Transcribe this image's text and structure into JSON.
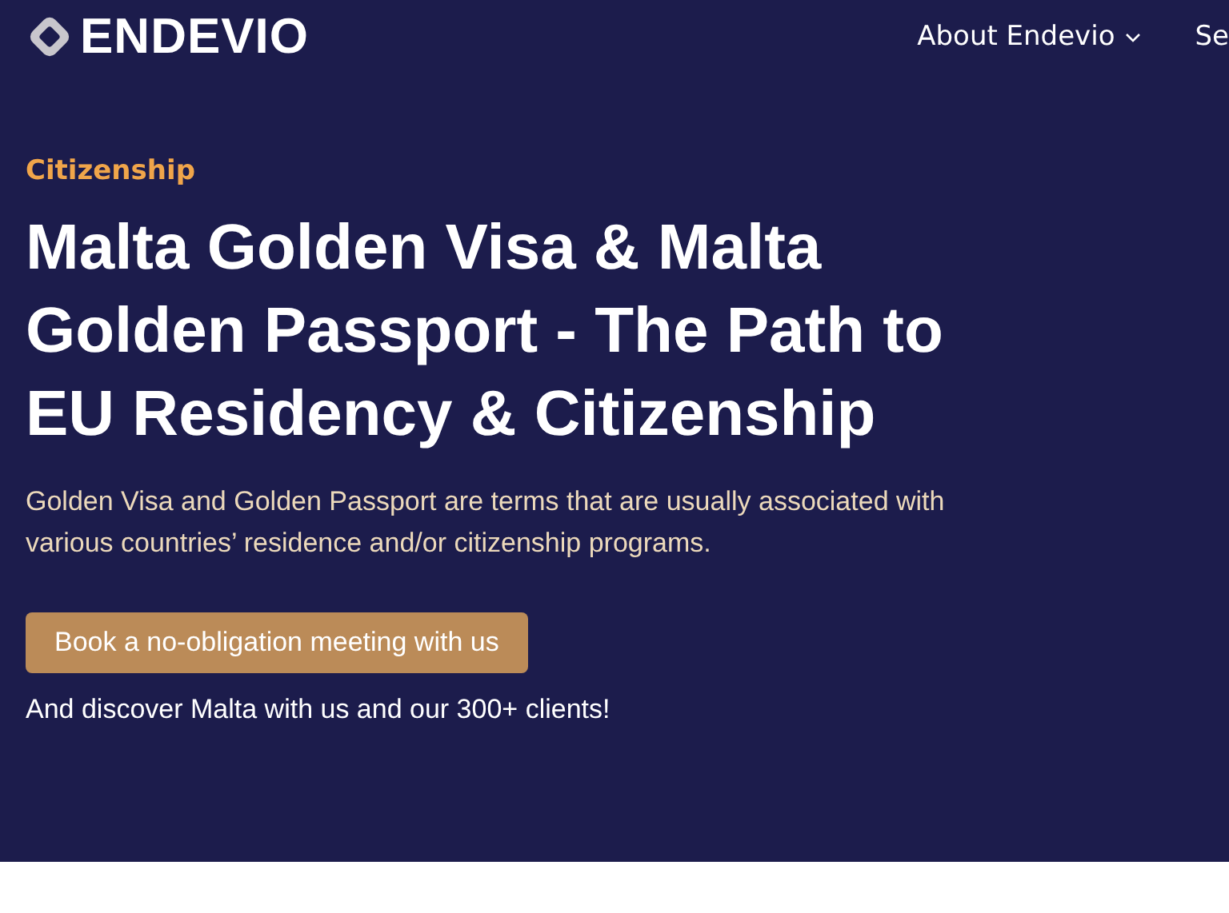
{
  "header": {
    "logo": "ENDEVIO",
    "nav": [
      {
        "label": "About Endevio",
        "has_dropdown": true
      },
      {
        "label": "Se",
        "has_dropdown": false
      }
    ]
  },
  "hero": {
    "category": "Citizenship",
    "title": "Malta Golden Visa & Malta Golden Passport - The Path to EU Residency & Citizenship",
    "description": "Golden Visa and Golden Passport are terms that are usually associated with various countries’ residence and/or citizenship programs.",
    "button": "Book a no-obligation meeting with us",
    "note": "And discover Malta with us and our 300+ clients!"
  }
}
